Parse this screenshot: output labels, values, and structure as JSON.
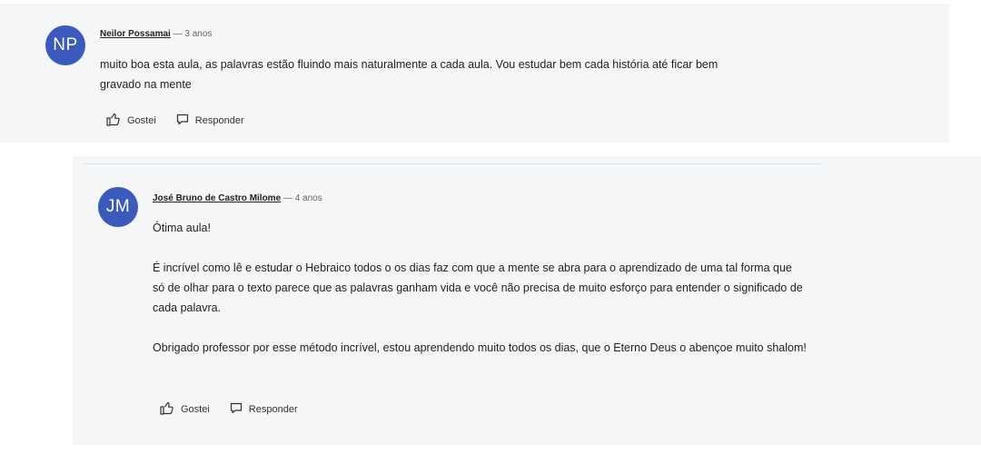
{
  "comments": [
    {
      "avatar_initials": "NP",
      "author": "Neilor Possamai",
      "separator": "—",
      "time": "3 anos",
      "paragraphs": [
        "muito boa esta aula, as palavras estão fluindo mais naturalmente a cada aula. Vou estudar bem cada história até ficar bem gravado na mente"
      ],
      "like_label": "Gostei",
      "reply_label": "Responder"
    },
    {
      "avatar_initials": "JM",
      "author": "José Bruno de Castro Milome",
      "separator": "—",
      "time": "4 anos",
      "paragraphs": [
        "Ótima aula!",
        "É incrível como lê e estudar o Hebraico todos o os dias faz com que a mente se abra para o aprendizado de uma tal forma que só de olhar para o texto parece que as palavras ganham vida e você não precisa de muito esforço para entender o significado de cada palavra.",
        "Obrigado professor por esse método incrível, estou aprendendo muito todos os dias, que o Eterno Deus o abençoe muito shalom!"
      ],
      "like_label": "Gostei",
      "reply_label": "Responder"
    }
  ],
  "colors": {
    "avatar_bg": "#3a5bbd",
    "card_bg": "#f4f6f8"
  },
  "icons": {
    "like": "thumbs-up-icon",
    "reply": "speech-bubble-icon"
  }
}
